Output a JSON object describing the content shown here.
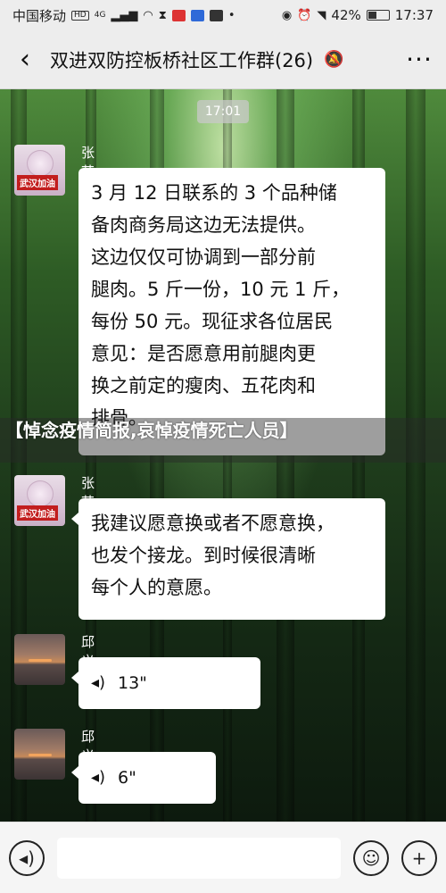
{
  "status_bar": {
    "carrier": "中国移动",
    "network": "4G",
    "battery": "42%",
    "battery_level": 0.42,
    "time": "17:37"
  },
  "header": {
    "title": "双进双防控板桥社区工作群(26)",
    "back_icon": "chevron-left-icon",
    "mute_icon": "bell-muted-icon",
    "more_icon": "more-dots-icon"
  },
  "chat": {
    "timestamp": "17:01",
    "messages": [
      {
        "sender": "张艺",
        "avatar_label": "武汉加油",
        "text_lines": [
          "3 月 12 日联系的 3 个品种储",
          "备肉商务局这边无法提供。",
          "这边仅仅可协调到一部分前",
          "腿肉。5 斤一份，10 元 1 斤，",
          "每份 50 元。现征求各位居民",
          "意见：是否愿意用前腿肉更",
          "换之前定的瘦肉、五花肉和",
          "排骨。"
        ]
      },
      {
        "sender": "张艺",
        "avatar_label": "武汉加油",
        "text_lines": [
          "我建议愿意换或者不愿意换，",
          "也发个接龙。到时候很清晰",
          "每个人的意愿。"
        ]
      },
      {
        "sender": "邱义斌",
        "voice_duration": "13\""
      },
      {
        "sender": "邱义斌",
        "voice_duration": "6\""
      }
    ]
  },
  "overlay": {
    "caption": "【悼念疫情简报,哀悼疫情死亡人员】"
  },
  "input_bar": {
    "voice_icon": "voice-icon",
    "emoji_icon": "emoji-icon",
    "plus_icon": "plus-icon"
  }
}
